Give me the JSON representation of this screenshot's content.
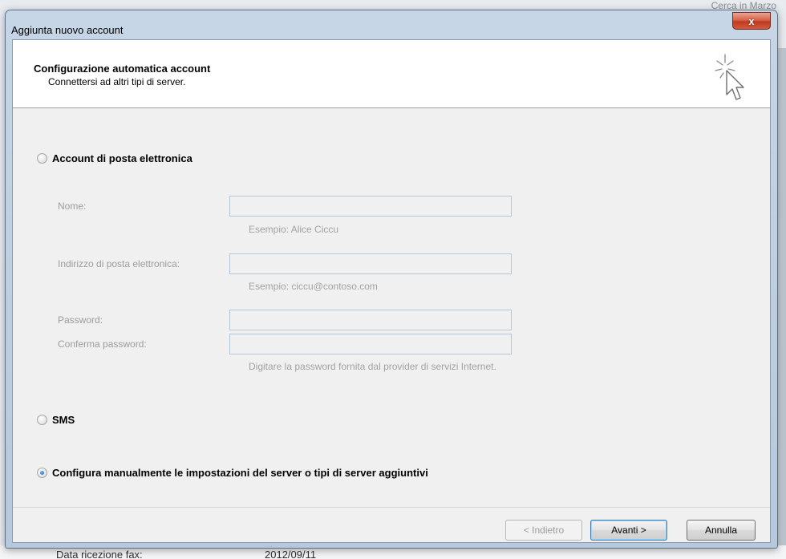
{
  "background": {
    "top_right_text": "Cerca in Marzo",
    "bottom_label": "Data ricezione fax:",
    "bottom_value": "2012/09/11"
  },
  "dialog": {
    "title": "Aggiunta nuovo account",
    "close_glyph": "x",
    "header": {
      "title": "Configurazione automatica account",
      "subtitle": "Connettersi ad altri tipi di server.",
      "icon": "wizard-cursor-icon"
    },
    "options": [
      {
        "label": "Account di posta elettronica",
        "selected": false
      },
      {
        "label": "SMS",
        "selected": false
      },
      {
        "label": "Configura manualmente le impostazioni del server o tipi di server aggiuntivi",
        "selected": true
      }
    ],
    "fields": {
      "name_label": "Nome:",
      "name_value": "",
      "name_hint": "Esempio: Alice Ciccu",
      "email_label": "Indirizzo di posta elettronica:",
      "email_value": "",
      "email_hint": "Esempio: ciccu@contoso.com",
      "password_label": "Password:",
      "password_value": "",
      "confirm_label": "Conferma password:",
      "confirm_value": "",
      "password_hint": "Digitare la password fornita dal provider di servizi Internet."
    },
    "buttons": {
      "back": "< Indietro",
      "next": "Avanti >",
      "cancel": "Annulla"
    }
  },
  "colors": {
    "radio_selected": "#1d5fb3",
    "close_button": "#c03a1f",
    "disabled_text": "#9c9c9c"
  }
}
